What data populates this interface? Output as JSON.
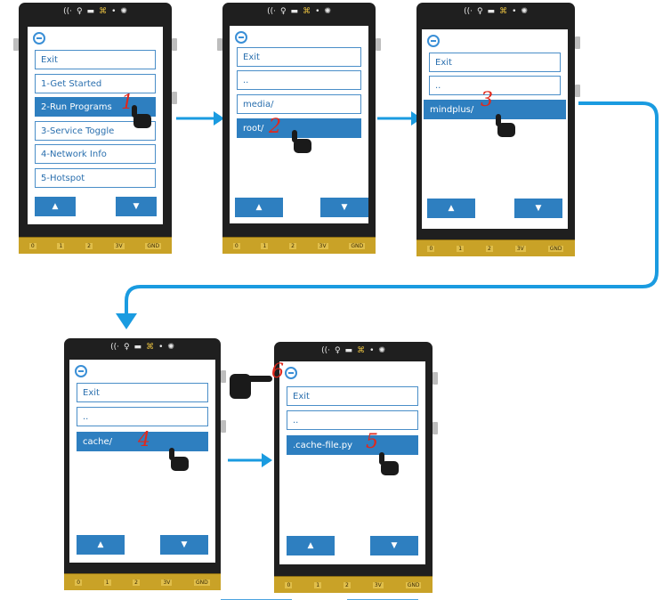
{
  "status_icons": [
    "wifi-icon",
    "mic-icon",
    "battery-icon",
    "buzzer-icon",
    "usb-icon",
    "light-icon"
  ],
  "connector_pins": [
    "0",
    "1",
    "2",
    "3V",
    "GND"
  ],
  "nav": {
    "up": "▲",
    "down": "▼"
  },
  "screens": [
    {
      "id": "screen1",
      "items": [
        "Exit",
        "1-Get Started",
        "2-Run Programs",
        "3-Service Toggle",
        "4-Network Info",
        "5-Hotspot"
      ],
      "selected": 2,
      "step": "1"
    },
    {
      "id": "screen2",
      "items": [
        "Exit",
        "..",
        "media/",
        "root/"
      ],
      "selected": 3,
      "step": "2"
    },
    {
      "id": "screen3",
      "items": [
        "Exit",
        "..",
        "mindplus/"
      ],
      "selected": 2,
      "step": "3"
    },
    {
      "id": "screen4",
      "items": [
        "Exit",
        "..",
        "cache/"
      ],
      "selected": 2,
      "step": "4"
    },
    {
      "id": "screen5",
      "items": [
        "Exit",
        "..",
        ".cache-file.py"
      ],
      "selected": 2,
      "step": "5"
    }
  ],
  "step6": "6",
  "colors": {
    "accent": "#2e7fc0",
    "arrow": "#1a9be0",
    "step_number": "#e0281c"
  }
}
